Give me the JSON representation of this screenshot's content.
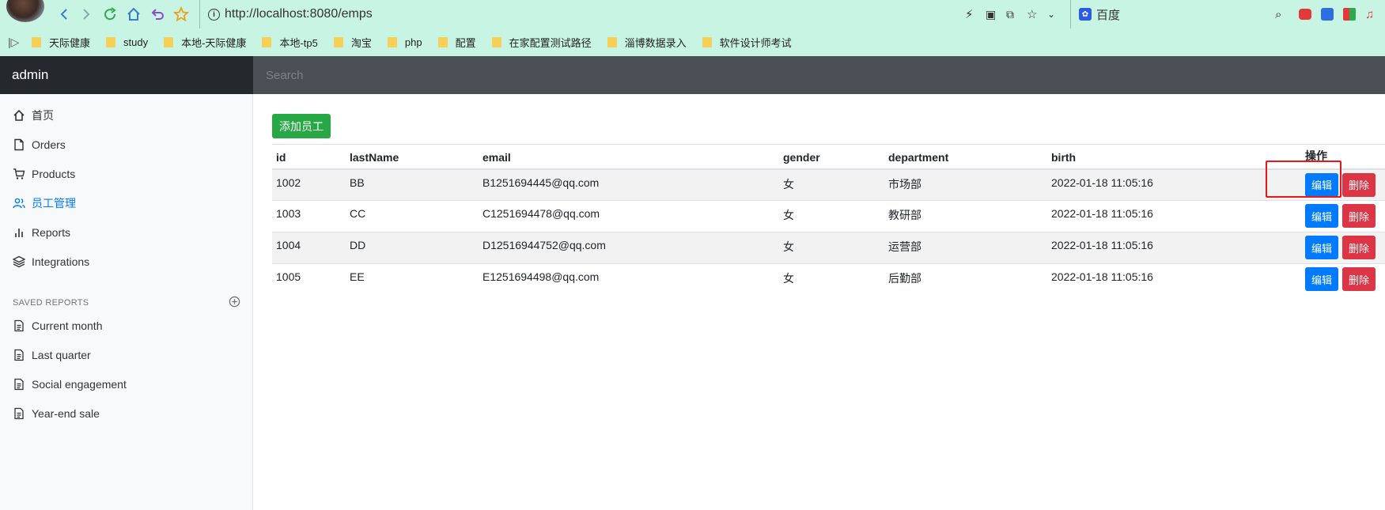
{
  "browser": {
    "url": "http://localhost:8080/emps",
    "search_engine": "百度",
    "bookmarks": [
      "天际健康",
      "study",
      "本地-天际健康",
      "本地-tp5",
      "淘宝",
      "php",
      "配置",
      "在家配置测试路径",
      "淄博数据录入",
      "软件设计师考试"
    ]
  },
  "navbar": {
    "brand": "admin",
    "search_placeholder": "Search"
  },
  "sidebar": {
    "items": [
      {
        "label": "首页",
        "icon": "home-icon"
      },
      {
        "label": "Orders",
        "icon": "file-icon"
      },
      {
        "label": "Products",
        "icon": "cart-icon"
      },
      {
        "label": "员工管理",
        "icon": "users-icon"
      },
      {
        "label": "Reports",
        "icon": "bar-chart-icon"
      },
      {
        "label": "Integrations",
        "icon": "layers-icon"
      }
    ],
    "saved_reports_header": "SAVED REPORTS",
    "saved_reports": [
      "Current month",
      "Last quarter",
      "Social engagement",
      "Year-end sale"
    ]
  },
  "main": {
    "add_button": "添加员工",
    "table": {
      "headers": [
        "id",
        "lastName",
        "email",
        "gender",
        "department",
        "birth",
        "操作"
      ],
      "rows": [
        {
          "id": "1002",
          "lastName": "BB",
          "email": "B1251694445@qq.com",
          "gender": "女",
          "department": "市场部",
          "birth": "2022-01-18 11:05:16"
        },
        {
          "id": "1003",
          "lastName": "CC",
          "email": "C1251694478@qq.com",
          "gender": "女",
          "department": "教研部",
          "birth": "2022-01-18 11:05:16"
        },
        {
          "id": "1004",
          "lastName": "DD",
          "email": "D12516944752@qq.com",
          "gender": "女",
          "department": "运营部",
          "birth": "2022-01-18 11:05:16"
        },
        {
          "id": "1005",
          "lastName": "EE",
          "email": "E1251694498@qq.com",
          "gender": "女",
          "department": "后勤部",
          "birth": "2022-01-18 11:05:16"
        }
      ],
      "edit_label": "编辑",
      "delete_label": "删除"
    }
  },
  "colors": {
    "browser_bg": "#c8f4e4",
    "navbar": "#343a40",
    "success": "#28a745",
    "primary": "#007bff",
    "danger": "#dc3545",
    "highlight": "#e81818"
  }
}
